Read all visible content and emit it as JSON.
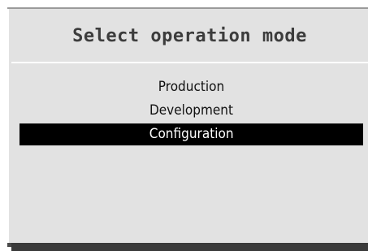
{
  "dialog": {
    "title": "Select operation mode",
    "options": [
      {
        "label": "Production",
        "selected": false
      },
      {
        "label": "Development",
        "selected": false
      },
      {
        "label": "Configuration",
        "selected": true
      }
    ]
  },
  "colors": {
    "background": "#e2e2e2",
    "selected_bg": "#000000",
    "selected_fg": "#ffffff",
    "title_color": "#3c3c3c"
  }
}
